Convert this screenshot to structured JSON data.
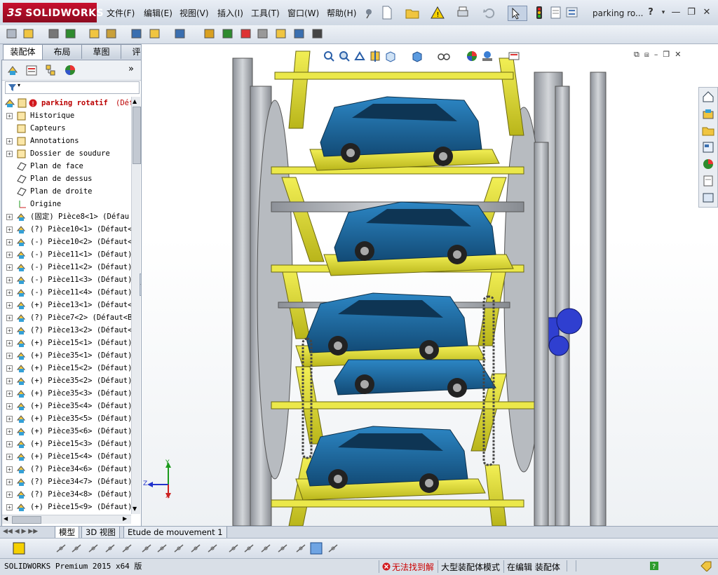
{
  "app": {
    "brand_ds": "3S",
    "brand_name": "SOLIDWORKS",
    "document_title": "parking ro..."
  },
  "menu": [
    "文件(F)",
    "编辑(E)",
    "视图(V)",
    "插入(I)",
    "工具(T)",
    "窗口(W)",
    "帮助(H)"
  ],
  "tabs": [
    {
      "label": "装配体",
      "active": true
    },
    {
      "label": "布局",
      "active": false
    },
    {
      "label": "草图",
      "active": false
    },
    {
      "label": "评估",
      "active": false
    }
  ],
  "tree": {
    "root": {
      "label": "parking rotatif",
      "suffix": "(Déf"
    },
    "items": [
      {
        "label": "Historique",
        "expand": true,
        "icon": "history-icon"
      },
      {
        "label": "Capteurs",
        "expand": false,
        "icon": "sensor-icon"
      },
      {
        "label": "Annotations",
        "expand": true,
        "icon": "annotation-icon"
      },
      {
        "label": "Dossier de soudure",
        "expand": true,
        "icon": "weld-folder-icon"
      },
      {
        "label": "Plan de face",
        "expand": false,
        "icon": "plane-icon"
      },
      {
        "label": "Plan de dessus",
        "expand": false,
        "icon": "plane-icon"
      },
      {
        "label": "Plan de droite",
        "expand": false,
        "icon": "plane-icon"
      },
      {
        "label": "Origine",
        "expand": false,
        "icon": "origin-icon"
      },
      {
        "label": "(固定) Pièce8<1> (Défau",
        "expand": true,
        "icon": "part-icon"
      },
      {
        "label": "(?) Pièce10<1> (Défaut<",
        "expand": true,
        "icon": "part-icon"
      },
      {
        "label": "(-) Pièce10<2> (Défaut<",
        "expand": true,
        "icon": "part-icon"
      },
      {
        "label": "(-) Pièce11<1> (Défaut)",
        "expand": true,
        "icon": "part-icon"
      },
      {
        "label": "(-) Pièce11<2> (Défaut)",
        "expand": true,
        "icon": "part-icon"
      },
      {
        "label": "(-) Pièce11<3> (Défaut)",
        "expand": true,
        "icon": "part-icon"
      },
      {
        "label": "(-) Pièce11<4> (Défaut)",
        "expand": true,
        "icon": "part-icon"
      },
      {
        "label": "(+) Pièce13<1> (Défaut<",
        "expand": true,
        "icon": "part-icon"
      },
      {
        "label": "(?) Pièce7<2> (Défaut<B",
        "expand": true,
        "icon": "part-icon"
      },
      {
        "label": "(?) Pièce13<2> (Défaut<",
        "expand": true,
        "icon": "part-icon"
      },
      {
        "label": "(+) Pièce15<1> (Défaut)",
        "expand": true,
        "icon": "part-icon"
      },
      {
        "label": "(+) Pièce35<1> (Défaut)",
        "expand": true,
        "icon": "part-icon"
      },
      {
        "label": "(+) Pièce15<2> (Défaut)",
        "expand": true,
        "icon": "part-icon"
      },
      {
        "label": "(+) Pièce35<2> (Défaut)",
        "expand": true,
        "icon": "part-icon"
      },
      {
        "label": "(+) Pièce35<3> (Défaut)",
        "expand": true,
        "icon": "part-icon"
      },
      {
        "label": "(+) Pièce35<4> (Défaut)",
        "expand": true,
        "icon": "part-icon"
      },
      {
        "label": "(+) Pièce35<5> (Défaut)",
        "expand": true,
        "icon": "part-icon"
      },
      {
        "label": "(+) Pièce35<6> (Défaut)",
        "expand": true,
        "icon": "part-icon"
      },
      {
        "label": "(+) Pièce15<3> (Défaut)",
        "expand": true,
        "icon": "part-icon"
      },
      {
        "label": "(+) Pièce15<4> (Défaut)",
        "expand": true,
        "icon": "part-icon"
      },
      {
        "label": "(?) Pièce34<6> (Défaut)",
        "expand": true,
        "icon": "part-icon"
      },
      {
        "label": "(?) Pièce34<7> (Défaut)",
        "expand": true,
        "icon": "part-icon"
      },
      {
        "label": "(?) Pièce34<8> (Défaut)",
        "expand": true,
        "icon": "part-icon"
      },
      {
        "label": "(+) Pièce15<9> (Défaut)",
        "expand": true,
        "icon": "part-icon"
      }
    ]
  },
  "bottom_tabs": [
    {
      "label": "模型",
      "active": true
    },
    {
      "label": "3D 视图",
      "active": false
    },
    {
      "label": "Etude de mouvement 1",
      "active": false
    }
  ],
  "triad": {
    "y": "Y",
    "z": "Z",
    "x": "X"
  },
  "status": {
    "product": "SOLIDWORKS Premium 2015 x64 版",
    "error": "无法找到解",
    "mode": "大型装配体模式",
    "editing": "在编辑 装配体"
  },
  "colors": {
    "frame_yellow": "#e0dd1e",
    "car_blue": "#1f6a9e",
    "steel_gray": "#a9adb3",
    "brand_red": "#c8102e"
  }
}
